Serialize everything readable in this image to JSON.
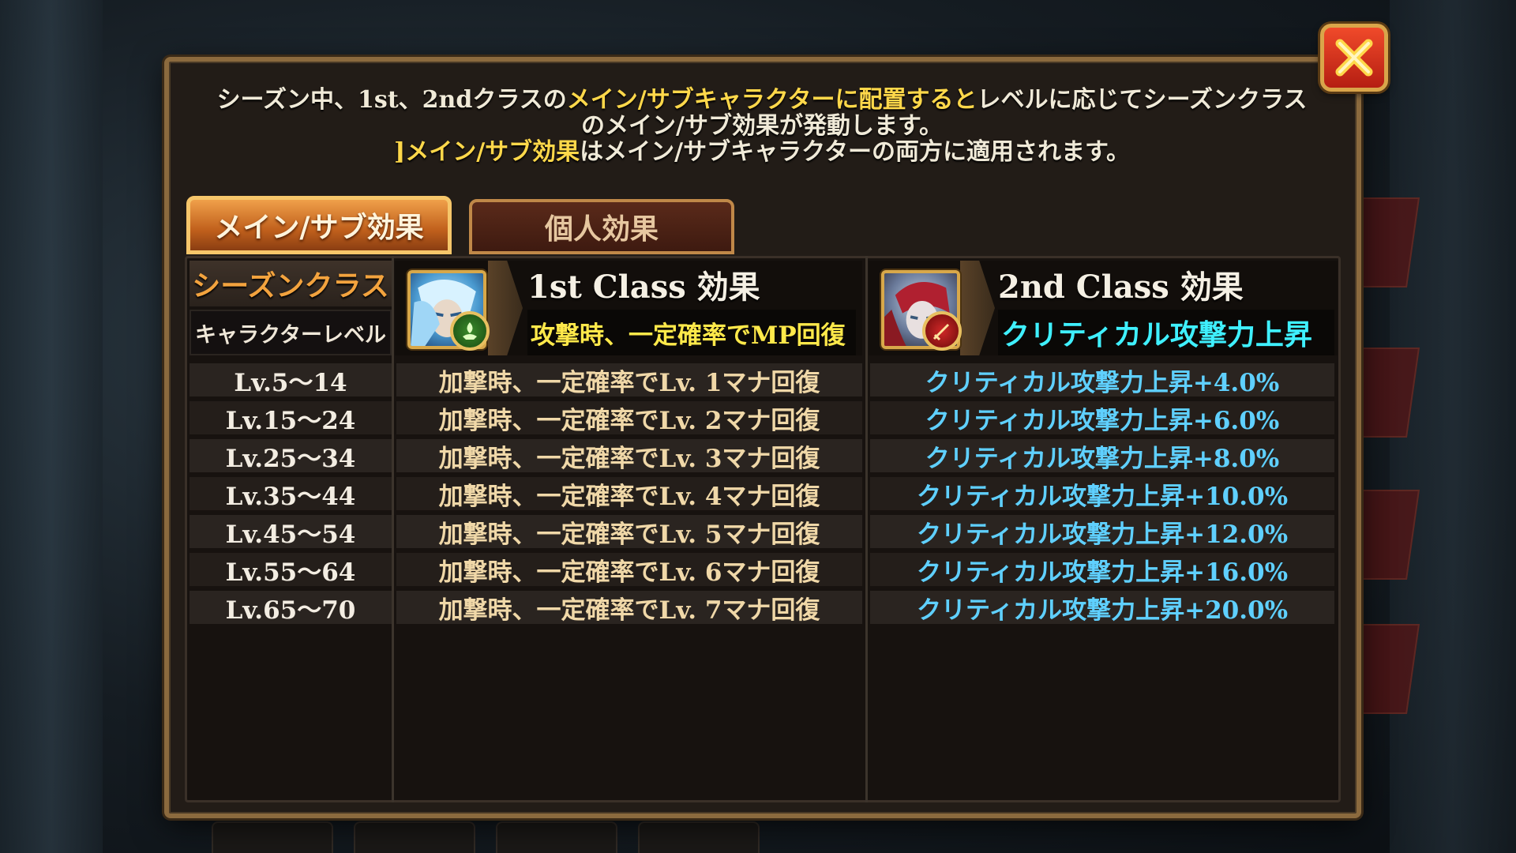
{
  "description": {
    "line1_a": "シーズン中、1st、2ndクラスの",
    "line1_b": "メイン/サブキャラクターに配置すると",
    "line1_c": "レベルに応じてシーズンクラス",
    "line2": "のメイン/サブ効果が発動します。",
    "line3_a": "]メイン/サブ効果",
    "line3_b": "はメイン/サブキャラクターの両方に適用されます。"
  },
  "tabs": [
    {
      "label": "メイン/サブ効果",
      "active": true
    },
    {
      "label": "個人効果",
      "active": false
    }
  ],
  "left_header": {
    "title": "シーズンクラス",
    "subtitle": "キャラクターレベル"
  },
  "class1": {
    "title": "1st Class 効果",
    "effect": "攻撃時、一定確率でMP回復",
    "effect_color": "#ffe94a",
    "badge_icon": "mana-recovery-icon"
  },
  "class2": {
    "title": "2nd Class 効果",
    "effect": "クリティカル攻撃力上昇",
    "effect_color": "#3ff0ff",
    "badge_icon": "critical-sword-icon"
  },
  "rows": [
    {
      "level": "Lv.5～14",
      "c1": "加撃時、一定確率でLv. 1マナ回復",
      "c2": "クリティカル攻撃力上昇+4.0%"
    },
    {
      "level": "Lv.15～24",
      "c1": "加撃時、一定確率でLv. 2マナ回復",
      "c2": "クリティカル攻撃力上昇+6.0%"
    },
    {
      "level": "Lv.25～34",
      "c1": "加撃時、一定確率でLv. 3マナ回復",
      "c2": "クリティカル攻撃力上昇+8.0%"
    },
    {
      "level": "Lv.35～44",
      "c1": "加撃時、一定確率でLv. 4マナ回復",
      "c2": "クリティカル攻撃力上昇+10.0%"
    },
    {
      "level": "Lv.45～54",
      "c1": "加撃時、一定確率でLv. 5マナ回復",
      "c2": "クリティカル攻撃力上昇+12.0%"
    },
    {
      "level": "Lv.55～64",
      "c1": "加撃時、一定確率でLv. 6マナ回復",
      "c2": "クリティカル攻撃力上昇+16.0%"
    },
    {
      "level": "Lv.65～70",
      "c1": "加撃時、一定確率でLv. 7マナ回復",
      "c2": "クリティカル攻撃力上昇+20.0%"
    }
  ],
  "colors": {
    "accent_orange": "#f3a33e",
    "highlight_yellow": "#ffd84a",
    "cyan_value": "#5fd0ff",
    "close_red": "#e03a22"
  },
  "icons": {
    "close": "close-icon"
  }
}
